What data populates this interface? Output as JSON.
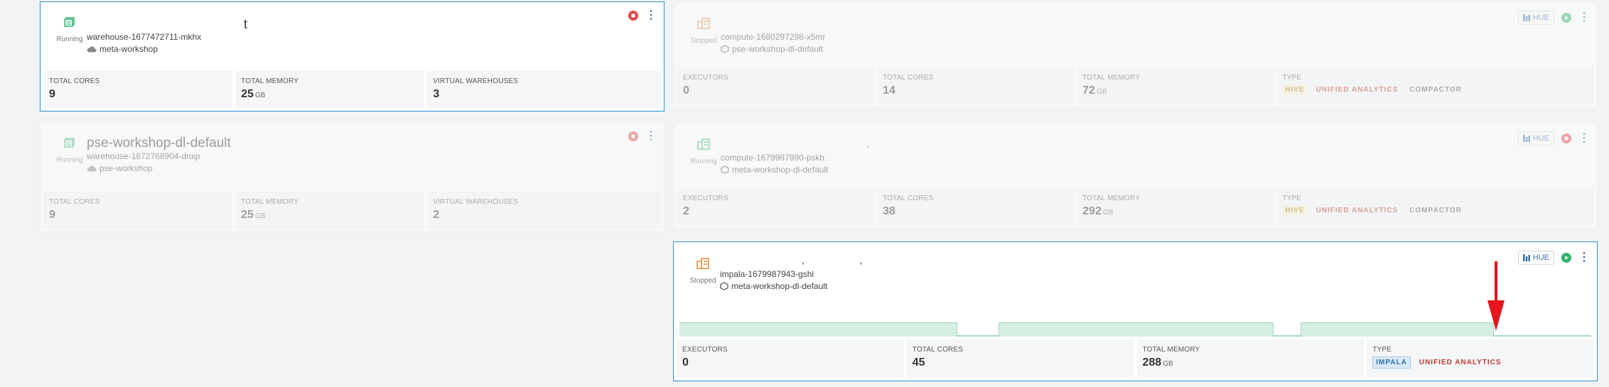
{
  "cards": {
    "dw1": {
      "status": "Running",
      "name": "t",
      "id": "warehouse-1677472711-mkhx",
      "env": "meta-workshop",
      "metrics": [
        {
          "label": "TOTAL CORES",
          "value": "9",
          "unit": ""
        },
        {
          "label": "TOTAL MEMORY",
          "value": "25",
          "unit": "GB"
        },
        {
          "label": "VIRTUAL WAREHOUSES",
          "value": "3",
          "unit": ""
        }
      ]
    },
    "dw2": {
      "status": "Running",
      "name": "pse-workshop-dl-default",
      "id": "warehouse-1672768904-dnxp",
      "env": "pse-workshop",
      "metrics": [
        {
          "label": "TOTAL CORES",
          "value": "9",
          "unit": ""
        },
        {
          "label": "TOTAL MEMORY",
          "value": "25",
          "unit": "GB"
        },
        {
          "label": "VIRTUAL WAREHOUSES",
          "value": "2",
          "unit": ""
        }
      ]
    },
    "vw1": {
      "status": "Stopped",
      "id": "compute-1680297298-x5mr",
      "env": "pse-workshop-dl-default",
      "hue": "HUE",
      "metrics": [
        {
          "label": "EXECUTORS",
          "value": "0",
          "unit": ""
        },
        {
          "label": "TOTAL CORES",
          "value": "14",
          "unit": ""
        },
        {
          "label": "TOTAL MEMORY",
          "value": "72",
          "unit": "GB"
        }
      ],
      "type_label": "TYPE",
      "tags": [
        "HIVE",
        "UNIFIED ANALYTICS",
        "COMPACTOR"
      ]
    },
    "vw2": {
      "status": "Running",
      "name": ",",
      "id": "compute-1679987990-pskb",
      "env": "meta-workshop-dl-default",
      "hue": "HUE",
      "metrics": [
        {
          "label": "EXECUTORS",
          "value": "2",
          "unit": ""
        },
        {
          "label": "TOTAL CORES",
          "value": "38",
          "unit": ""
        },
        {
          "label": "TOTAL MEMORY",
          "value": "292",
          "unit": "GB"
        }
      ],
      "type_label": "TYPE",
      "tags": [
        "HIVE",
        "UNIFIED ANALYTICS",
        "COMPACTOR"
      ]
    },
    "vw3": {
      "status": "Stopped",
      "name": ",                    ,",
      "id": "impala-1679987943-gshl",
      "env": "meta-workshop-dl-default",
      "hue": "HUE",
      "metrics": [
        {
          "label": "EXECUTORS",
          "value": "0",
          "unit": ""
        },
        {
          "label": "TOTAL CORES",
          "value": "45",
          "unit": ""
        },
        {
          "label": "TOTAL MEMORY",
          "value": "288",
          "unit": "GB"
        }
      ],
      "type_label": "TYPE",
      "tags": [
        "IMPALA",
        "UNIFIED ANALYTICS"
      ]
    }
  },
  "colors": {
    "accent": "#2a8fd6",
    "running": "#2fb36b",
    "stopped": "#e8893a",
    "danger": "#e04848",
    "arrow": "#e8141b"
  }
}
